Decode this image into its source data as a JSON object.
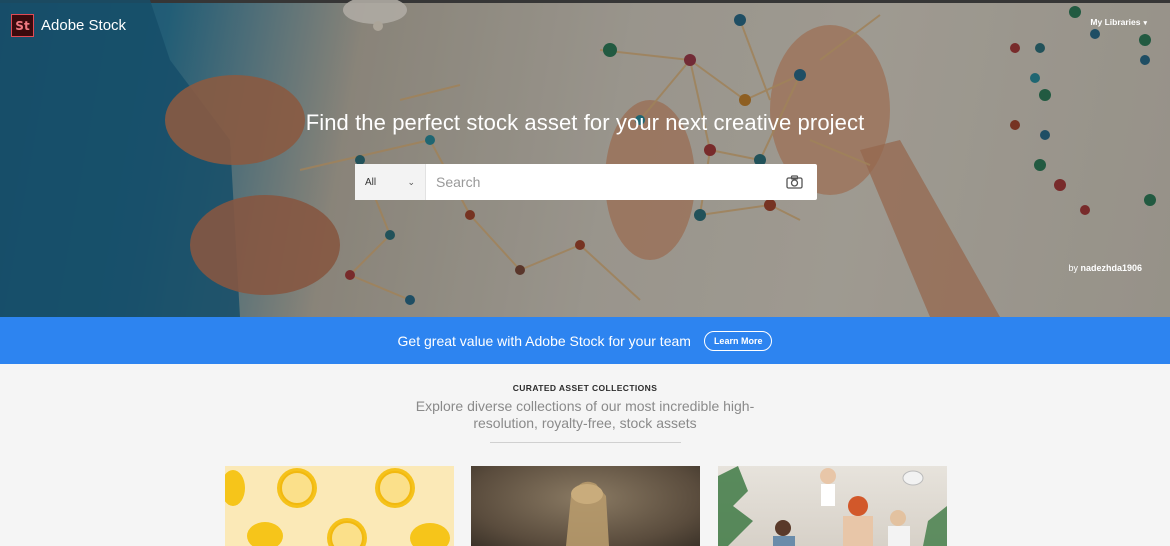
{
  "header": {
    "logo_text": "St",
    "brand_name": "Adobe Stock",
    "my_libraries_label": "My Libraries"
  },
  "hero": {
    "headline": "Find the perfect stock asset for your next creative project",
    "search": {
      "category_value": "All",
      "placeholder": "Search",
      "value": ""
    },
    "credit_prefix": "by",
    "credit_author": "nadezhda1906"
  },
  "promo": {
    "text": "Get great value with Adobe Stock for your team",
    "button_label": "Learn More"
  },
  "collections": {
    "kicker": "CURATED ASSET COLLECTIONS",
    "subtitle": "Explore diverse collections of our most incredible high-resolution, royalty-free, stock assets"
  },
  "icons": {
    "chevron": "chevron-down-icon",
    "camera": "camera-icon",
    "logo": "adobe-stock-logo"
  },
  "colors": {
    "promo_bg": "#2d84f0",
    "logo_bg": "#3a0a0d",
    "logo_accent": "#e04a55"
  }
}
